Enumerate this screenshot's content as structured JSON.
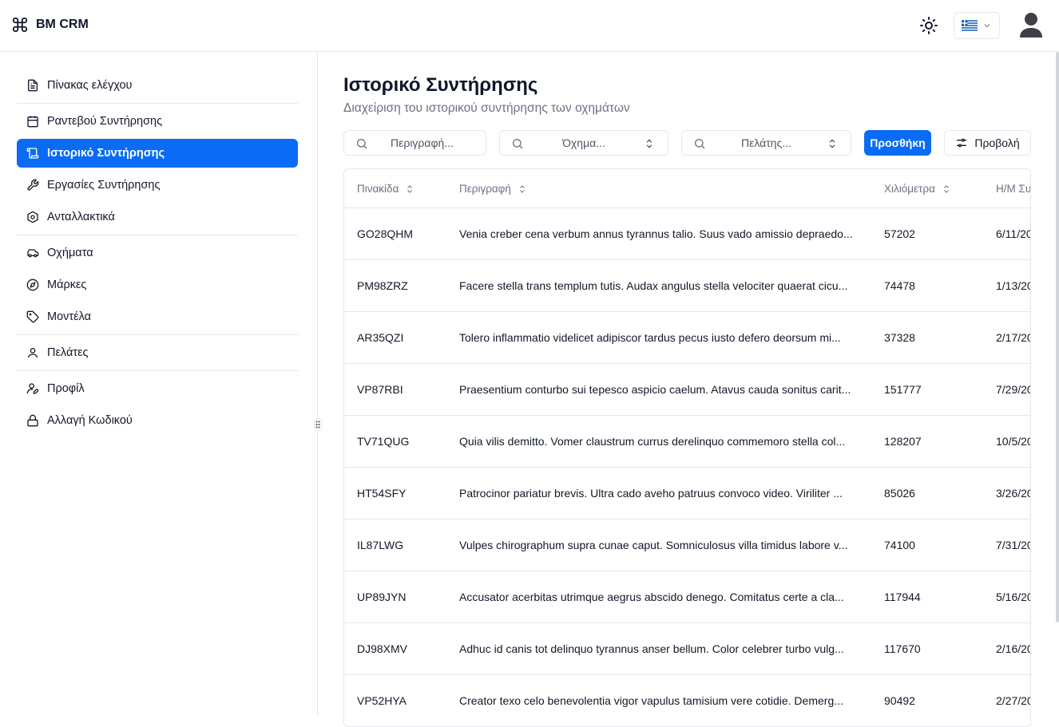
{
  "app": {
    "name": "BM CRM"
  },
  "sidebar": {
    "groups": [
      [
        {
          "label": "Πίνακας ελέγχου",
          "icon": "document-icon"
        }
      ],
      [
        {
          "label": "Ραντεβού Συντήρησης",
          "icon": "calendar-icon"
        },
        {
          "label": "Ιστορικό Συντήρησης",
          "icon": "scroll-icon",
          "active": true
        },
        {
          "label": "Εργασίες Συντήρησης",
          "icon": "wrench-icon"
        },
        {
          "label": "Ανταλλακτικά",
          "icon": "hexagon-icon"
        }
      ],
      [
        {
          "label": "Οχήματα",
          "icon": "car-icon"
        },
        {
          "label": "Μάρκες",
          "icon": "compass-icon"
        },
        {
          "label": "Μοντέλα",
          "icon": "tag-icon"
        }
      ],
      [
        {
          "label": "Πελάτες",
          "icon": "user-icon"
        }
      ],
      [
        {
          "label": "Προφίλ",
          "icon": "user-pen-icon"
        },
        {
          "label": "Αλλαγή Κωδικού",
          "icon": "lock-icon"
        }
      ]
    ]
  },
  "page": {
    "title": "Ιστορικό Συντήρησης",
    "subtitle": "Διαχείριση του ιστορικού συντήρησης των οχημάτων"
  },
  "filters": {
    "description_placeholder": "Περιγραφή...",
    "vehicle_placeholder": "Όχημα...",
    "customer_placeholder": "Πελάτης...",
    "add_label": "Προσθήκη",
    "view_label": "Προβολή"
  },
  "table": {
    "columns": [
      "Πινακίδα",
      "Περιγραφή",
      "Χιλιόμετρα",
      "Η/Μ Συ"
    ],
    "rows": [
      {
        "plate": "GO28QHM",
        "description": "Venia creber cena verbum annus tyrannus talio. Suus vado amissio depraedo...",
        "km": "57202",
        "date": "6/11/20"
      },
      {
        "plate": "PM98ZRZ",
        "description": "Facere stella trans templum tutis. Audax angulus stella velociter quaerat cicu...",
        "km": "74478",
        "date": "1/13/20"
      },
      {
        "plate": "AR35QZI",
        "description": "Tolero inflammatio videlicet adipiscor tardus pecus iusto defero deorsum mi...",
        "km": "37328",
        "date": "2/17/20"
      },
      {
        "plate": "VP87RBI",
        "description": "Praesentium conturbo sui tepesco aspicio caelum. Atavus cauda sonitus carit...",
        "km": "151777",
        "date": "7/29/20"
      },
      {
        "plate": "TV71QUG",
        "description": "Quia vilis demitto. Vomer claustrum currus derelinquo commemoro stella col...",
        "km": "128207",
        "date": "10/5/20"
      },
      {
        "plate": "HT54SFY",
        "description": "Patrocinor pariatur brevis. Ultra cado aveho patruus convoco video. Viriliter ...",
        "km": "85026",
        "date": "3/26/20"
      },
      {
        "plate": "IL87LWG",
        "description": "Vulpes chirographum supra cunae caput. Somniculosus villa timidus labore v...",
        "km": "74100",
        "date": "7/31/20"
      },
      {
        "plate": "UP89JYN",
        "description": "Accusator acerbitas utrimque aegrus abscido denego. Comitatus certe a cla...",
        "km": "117944",
        "date": "5/16/20"
      },
      {
        "plate": "DJ98XMV",
        "description": "Adhuc id canis tot delinquo tyrannus anser bellum. Color celebrer turbo vulg...",
        "km": "117670",
        "date": "2/16/20"
      },
      {
        "plate": "VP52HYA",
        "description": "Creator texo celo benevolentia vigor vapulus tamisium vere cotidie. Demerg...",
        "km": "90492",
        "date": "2/27/20"
      }
    ]
  },
  "colors": {
    "accent": "#0a6cf5",
    "border": "#e5e7eb",
    "muted": "#6b7280"
  }
}
